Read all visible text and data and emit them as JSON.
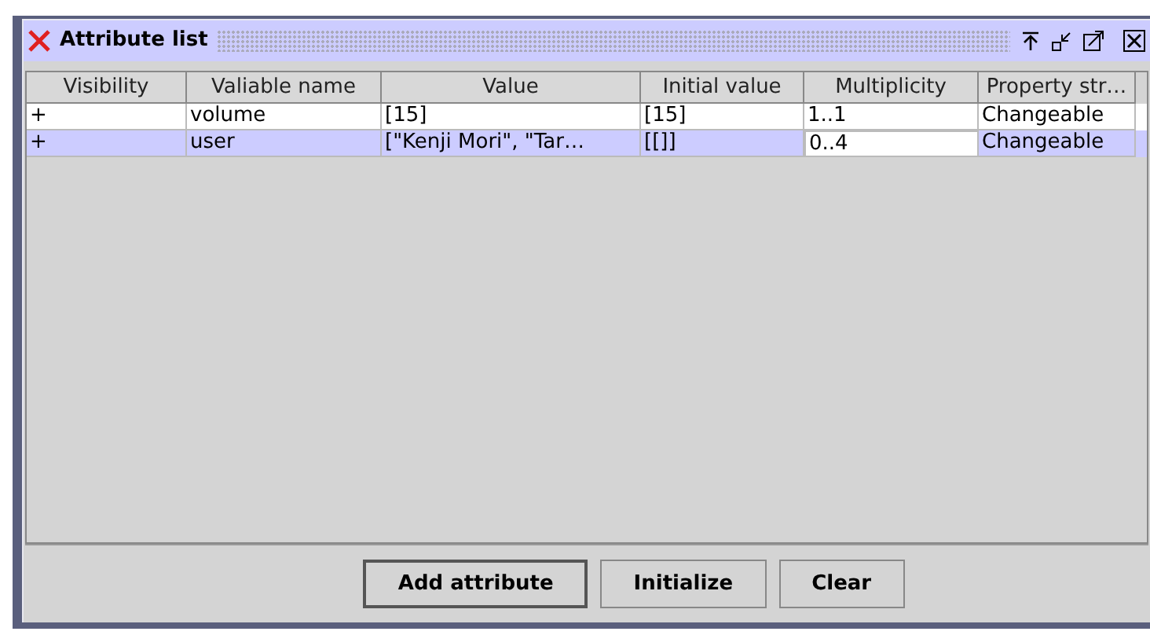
{
  "window": {
    "title": "Attribute list"
  },
  "table": {
    "columns": [
      "Visibility",
      "Valiable name",
      "Value",
      "Initial value",
      "Multiplicity",
      "Property str…"
    ],
    "rows": [
      {
        "selected": false,
        "cells": [
          {
            "text": "+",
            "focused": false
          },
          {
            "text": "volume",
            "focused": false
          },
          {
            "text": "[15]",
            "focused": false
          },
          {
            "text": "[15]",
            "focused": false
          },
          {
            "text": "1..1",
            "focused": false
          },
          {
            "text": "Changeable",
            "focused": false
          }
        ]
      },
      {
        "selected": true,
        "cells": [
          {
            "text": "+",
            "focused": false
          },
          {
            "text": "user",
            "focused": false
          },
          {
            "text": "[\"Kenji Mori\", \"Tar…",
            "focused": false
          },
          {
            "text": "[[]]",
            "focused": false
          },
          {
            "text": "0..4",
            "focused": true
          },
          {
            "text": "Changeable",
            "focused": false
          }
        ]
      }
    ]
  },
  "buttons": [
    {
      "label": "Add attribute",
      "selected": true
    },
    {
      "label": "Initialize",
      "selected": false
    },
    {
      "label": "Clear",
      "selected": false
    }
  ]
}
